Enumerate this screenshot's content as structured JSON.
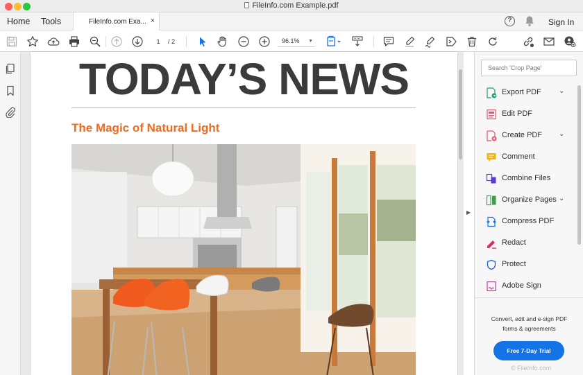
{
  "window": {
    "title": "FileInfo.com Example.pdf"
  },
  "tabbar": {
    "home": "Home",
    "tools": "Tools",
    "doc_tab": "FileInfo.com Exa...",
    "close": "×",
    "help": "?",
    "sign_in": "Sign In"
  },
  "toolbar": {
    "page_current": "1",
    "page_total": "/ 2",
    "zoom": "96.1%"
  },
  "document": {
    "headline": "TODAY’S NEWS",
    "subheading": "The Magic of Natural Light"
  },
  "right_panel": {
    "search_placeholder": "Search 'Crop Page'",
    "tools": [
      {
        "label": "Export PDF",
        "icon": "export-pdf-icon",
        "expandable": true,
        "color": "#1f9e6b"
      },
      {
        "label": "Edit PDF",
        "icon": "edit-pdf-icon",
        "expandable": false,
        "color": "#e4556e"
      },
      {
        "label": "Create PDF",
        "icon": "create-pdf-icon",
        "expandable": true,
        "color": "#e4556e"
      },
      {
        "label": "Comment",
        "icon": "comment-icon",
        "expandable": false,
        "color": "#f5b600"
      },
      {
        "label": "Combine Files",
        "icon": "combine-files-icon",
        "expandable": false,
        "color": "#5a3cc9"
      },
      {
        "label": "Organize Pages",
        "icon": "organize-pages-icon",
        "expandable": true,
        "color": "#3aa34a"
      },
      {
        "label": "Compress PDF",
        "icon": "compress-pdf-icon",
        "expandable": false,
        "color": "#1473e6"
      },
      {
        "label": "Redact",
        "icon": "redact-icon",
        "expandable": false,
        "color": "#d3306a"
      },
      {
        "label": "Protect",
        "icon": "protect-icon",
        "expandable": false,
        "color": "#1c5bd6"
      },
      {
        "label": "Adobe Sign",
        "icon": "adobe-sign-icon",
        "expandable": false,
        "color": "#b83fa6"
      }
    ],
    "promo_line1": "Convert, edit and e-sign PDF",
    "promo_line2": "forms & agreements",
    "trial_button": "Free 7-Day Trial",
    "watermark": "© FileInfo.com"
  },
  "colors": {
    "accent": "#1473e6",
    "subheading": "#f26a1b"
  }
}
